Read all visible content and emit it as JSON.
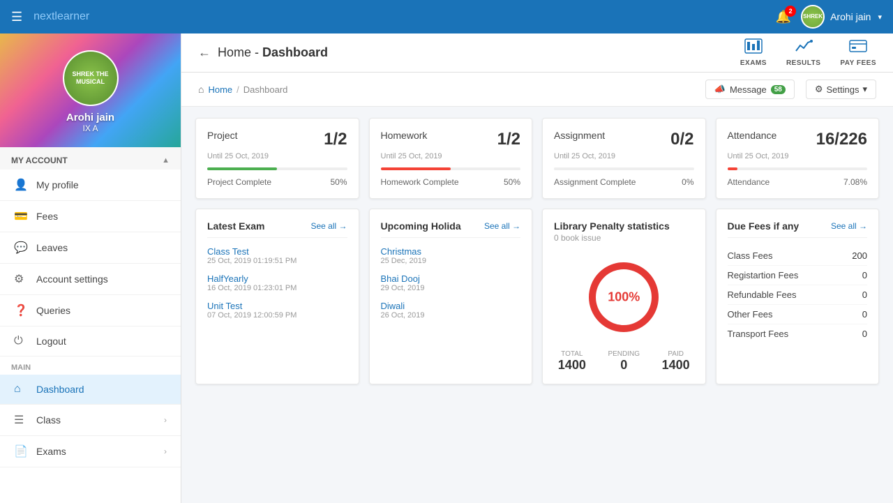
{
  "app": {
    "logo_prefix": "next",
    "logo_suffix": "learner"
  },
  "topnav": {
    "notification_count": "2",
    "user_name": "Arohi jain",
    "chevron": "▾"
  },
  "sidebar": {
    "profile": {
      "name": "Arohi jain",
      "class": "IX A"
    },
    "my_account_label": "My account",
    "items": [
      {
        "id": "my-profile",
        "label": "My profile",
        "icon": "👤"
      },
      {
        "id": "fees",
        "label": "Fees",
        "icon": "💳"
      },
      {
        "id": "leaves",
        "label": "Leaves",
        "icon": "💬"
      },
      {
        "id": "account-settings",
        "label": "Account settings",
        "icon": "⚙"
      },
      {
        "id": "queries",
        "label": "Queries",
        "icon": "❓"
      },
      {
        "id": "logout",
        "label": "Logout",
        "icon": "⏻"
      }
    ],
    "main_label": "MAIN",
    "main_items": [
      {
        "id": "dashboard",
        "label": "Dashboard",
        "icon": "⌂",
        "active": true
      },
      {
        "id": "class",
        "label": "Class",
        "icon": "☰",
        "has_arrow": true
      },
      {
        "id": "exams",
        "label": "Exams",
        "icon": "📄",
        "has_arrow": true
      }
    ]
  },
  "header": {
    "title_prefix": "Home",
    "title_sep": " - ",
    "title_suffix": "Dashboard",
    "actions": [
      {
        "id": "exams",
        "label": "EXAMS",
        "icon": "📊"
      },
      {
        "id": "results",
        "label": "RESULTS",
        "icon": "📈"
      },
      {
        "id": "pay-fees",
        "label": "PAY FEES",
        "icon": "💰"
      }
    ]
  },
  "breadcrumb": {
    "home": "Home",
    "current": "Dashboard",
    "message_label": "Message",
    "message_count": "58",
    "settings_label": "Settings"
  },
  "stats_cards": [
    {
      "id": "project",
      "title": "Project",
      "subtitle": "Until 25 Oct, 2019",
      "value": "1/2",
      "progress_pct": 50,
      "progress_color": "green",
      "footer_label": "Project Complete",
      "footer_value": "50%"
    },
    {
      "id": "homework",
      "title": "Homework",
      "subtitle": "Until 25 Oct, 2019",
      "value": "1/2",
      "progress_pct": 50,
      "progress_color": "red",
      "footer_label": "Homework Complete",
      "footer_value": "50%"
    },
    {
      "id": "assignment",
      "title": "Assignment",
      "subtitle": "Until 25 Oct, 2019",
      "value": "0/2",
      "progress_pct": 0,
      "progress_color": "green",
      "footer_label": "Assignment Complete",
      "footer_value": "0%"
    },
    {
      "id": "attendance",
      "title": "Attendance",
      "subtitle": "Until 25 Oct, 2019",
      "value": "16/226",
      "progress_pct": 7,
      "progress_color": "red",
      "footer_label": "Attendance",
      "footer_value": "7.08%"
    }
  ],
  "latest_exam": {
    "title": "Latest Exam",
    "see_all": "See all →",
    "items": [
      {
        "name": "Class Test",
        "date": "25 Oct, 2019 01:19:51 PM"
      },
      {
        "name": "HalfYearly",
        "date": "16 Oct, 2019 01:23:01 PM"
      },
      {
        "name": "Unit Test",
        "date": "07 Oct, 2019 12:00:59 PM"
      }
    ]
  },
  "upcoming_holidays": {
    "title": "Upcoming Holida",
    "see_all": "See all →",
    "items": [
      {
        "name": "Christmas",
        "date": "25 Dec, 2019"
      },
      {
        "name": "Bhai Dooj",
        "date": "29 Oct, 2019"
      },
      {
        "name": "Diwali",
        "date": "26 Oct, 2019"
      }
    ]
  },
  "library": {
    "title": "Library Penalty statistics",
    "book_issue": "0 book issue",
    "donut_pct": "100%",
    "total_label": "TOTAL",
    "total_value": "1400",
    "pending_label": "PENDING",
    "pending_value": "0",
    "paid_label": "PAID",
    "paid_value": "1400"
  },
  "due_fees": {
    "title": "Due Fees if any",
    "see_all": "See all →",
    "rows": [
      {
        "label": "Class Fees",
        "value": "200"
      },
      {
        "label": "Registartion Fees",
        "value": "0"
      },
      {
        "label": "Refundable Fees",
        "value": "0"
      },
      {
        "label": "Other Fees",
        "value": "0"
      },
      {
        "label": "Transport Fees",
        "value": "0"
      }
    ]
  }
}
